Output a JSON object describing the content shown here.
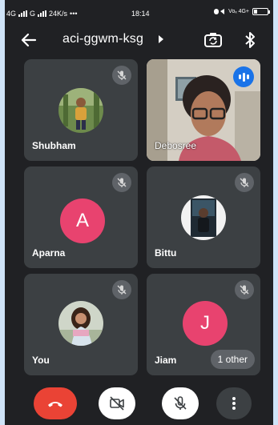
{
  "status_bar": {
    "network_1": "4G",
    "network_2": "G",
    "speed": "24K/s",
    "more": "•••",
    "time": "18:14",
    "volte": "Voₓ 4G+",
    "battery_level": 0.25
  },
  "toolbar": {
    "meeting_code": "aci-ggwm-ksg",
    "icons": [
      "back-arrow-icon",
      "caret-right-icon",
      "switch-camera-icon",
      "bluetooth-icon"
    ]
  },
  "participants": [
    {
      "name": "Shubham",
      "kind": "photo",
      "muted": true
    },
    {
      "name": "Debosree",
      "kind": "video",
      "speaking": true
    },
    {
      "name": "Aparna",
      "kind": "letter",
      "initial": "A",
      "color": "#e8436f",
      "muted": true
    },
    {
      "name": "Bittu",
      "kind": "photo",
      "muted": true
    },
    {
      "name": "You",
      "kind": "photo",
      "muted": true
    },
    {
      "name": "Jiam",
      "kind": "letter",
      "initial": "J",
      "color": "#e8436f",
      "muted": true,
      "extra": "1 other"
    }
  ],
  "controls": {
    "end_call_color": "#ea4335",
    "icons": [
      "end-call-icon",
      "camera-off-icon",
      "mic-off-icon",
      "more-vert-icon"
    ]
  }
}
